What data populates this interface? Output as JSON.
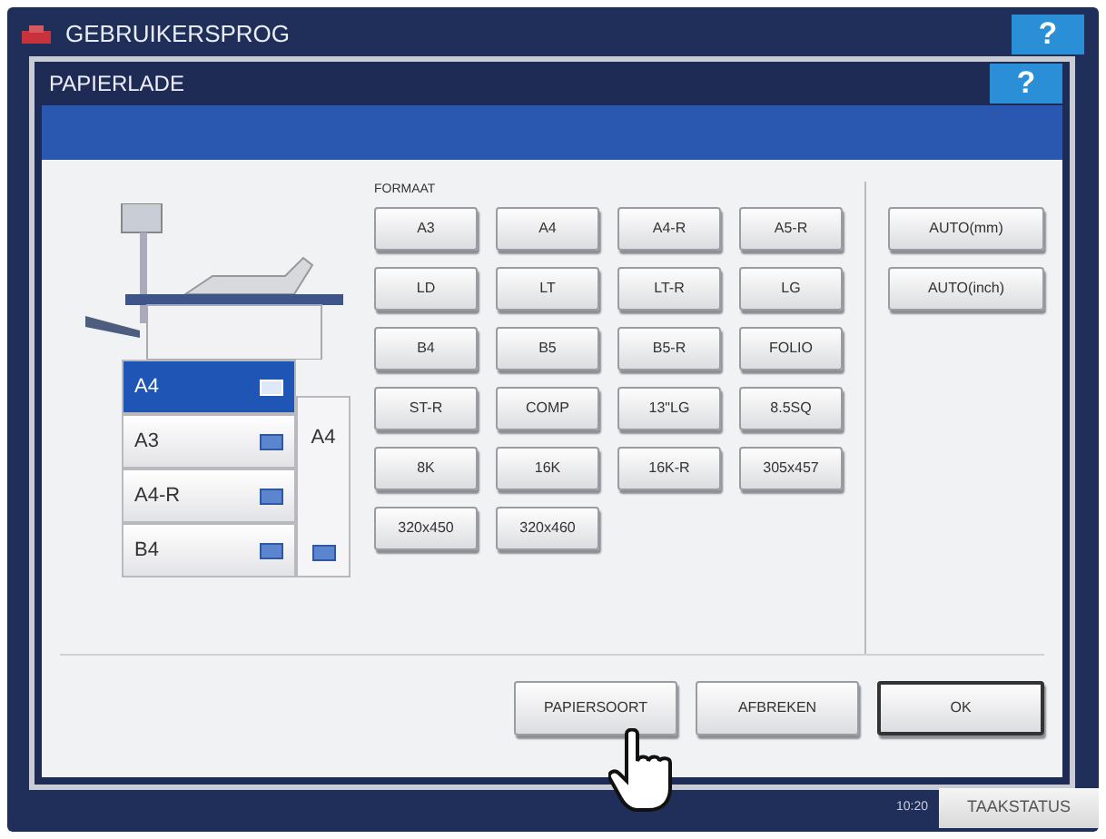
{
  "screen": {
    "title": "GEBRUIKERSPROG",
    "help": "?"
  },
  "dialog": {
    "title": "PAPIERLADE",
    "help": "?"
  },
  "trays": [
    {
      "label": "A4",
      "selected": true
    },
    {
      "label": "A3",
      "selected": false
    },
    {
      "label": "A4-R",
      "selected": false
    },
    {
      "label": "B4",
      "selected": false
    }
  ],
  "bypass": {
    "label": "A4"
  },
  "format_label": "FORMAAT",
  "formats": [
    "A3",
    "A4",
    "A4-R",
    "A5-R",
    "LD",
    "LT",
    "LT-R",
    "LG",
    "B4",
    "B5",
    "B5-R",
    "FOLIO",
    "ST-R",
    "COMP",
    "13\"LG",
    "8.5SQ",
    "8K",
    "16K",
    "16K-R",
    "305x457",
    "320x450",
    "320x460"
  ],
  "auto_buttons": [
    "AUTO(mm)",
    "AUTO(inch)"
  ],
  "footer_buttons": [
    {
      "label": "PAPIERSOORT",
      "kind": "menu"
    },
    {
      "label": "AFBREKEN",
      "kind": "plain"
    },
    {
      "label": "OK",
      "kind": "default"
    }
  ],
  "status": {
    "time": "10:20",
    "job_status": "TAAKSTATUS"
  }
}
